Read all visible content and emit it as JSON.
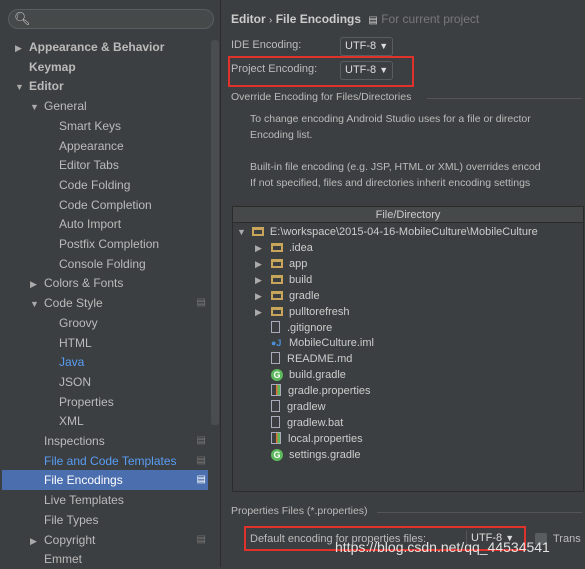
{
  "sidebar": {
    "search_placeholder": "",
    "items": [
      {
        "label": "Appearance & Behavior"
      },
      {
        "label": "Keymap"
      },
      {
        "label": "Editor"
      },
      {
        "label": "General"
      },
      {
        "label": "Smart Keys"
      },
      {
        "label": "Appearance"
      },
      {
        "label": "Editor Tabs"
      },
      {
        "label": "Code Folding"
      },
      {
        "label": "Code Completion"
      },
      {
        "label": "Auto Import"
      },
      {
        "label": "Postfix Completion"
      },
      {
        "label": "Console Folding"
      },
      {
        "label": "Colors & Fonts"
      },
      {
        "label": "Code Style"
      },
      {
        "label": "Groovy"
      },
      {
        "label": "HTML"
      },
      {
        "label": "Java"
      },
      {
        "label": "JSON"
      },
      {
        "label": "Properties"
      },
      {
        "label": "XML"
      },
      {
        "label": "Inspections"
      },
      {
        "label": "File and Code Templates"
      },
      {
        "label": "File Encodings"
      },
      {
        "label": "Live Templates"
      },
      {
        "label": "File Types"
      },
      {
        "label": "Copyright"
      },
      {
        "label": "Emmet"
      }
    ],
    "selected": "File Encodings"
  },
  "main": {
    "breadcrumb_parent": "Editor",
    "breadcrumb_sep": "›",
    "breadcrumb_current": "File Encodings",
    "scope_note": "For current project",
    "ide_encoding_label": "IDE Encoding:",
    "ide_encoding_value": "UTF-8",
    "project_encoding_label": "Project Encoding:",
    "project_encoding_value": "UTF-8",
    "override_title": "Override Encoding for Files/Directories",
    "info1_line1": "To change encoding Android Studio uses for a file or director",
    "info1_line2": "Encoding list.",
    "info2_line1": "Built-in file encoding (e.g. JSP, HTML or XML) overrides encod",
    "info2_line2": "If not specified, files and directories inherit encoding settings",
    "table": {
      "header": "File/Directory",
      "root": "E:\\workspace\\2015-04-16-MobileCulture\\MobileCulture",
      "rows": [
        {
          "name": ".idea",
          "type": "folder"
        },
        {
          "name": "app",
          "type": "folder"
        },
        {
          "name": "build",
          "type": "folder"
        },
        {
          "name": "gradle",
          "type": "folder"
        },
        {
          "name": "pulltorefresh",
          "type": "folder"
        },
        {
          "name": ".gitignore",
          "type": "text"
        },
        {
          "name": "MobileCulture.iml",
          "type": "iml"
        },
        {
          "name": "README.md",
          "type": "text"
        },
        {
          "name": "build.gradle",
          "type": "gradle"
        },
        {
          "name": "gradle.properties",
          "type": "properties"
        },
        {
          "name": "gradlew",
          "type": "text"
        },
        {
          "name": "gradlew.bat",
          "type": "text"
        },
        {
          "name": "local.properties",
          "type": "properties"
        },
        {
          "name": "settings.gradle",
          "type": "gradle"
        }
      ]
    },
    "properties_title": "Properties Files (*.properties)",
    "default_props_label": "Default encoding for properties files:",
    "default_props_value": "UTF-8",
    "transparent_label": "Trans"
  },
  "watermark": "https://blog.csdn.net/qq_44534541",
  "colors": {
    "selection": "#4b6eaf",
    "highlight": "#e0312b",
    "link": "#589df6",
    "background": "#3c3f41"
  }
}
